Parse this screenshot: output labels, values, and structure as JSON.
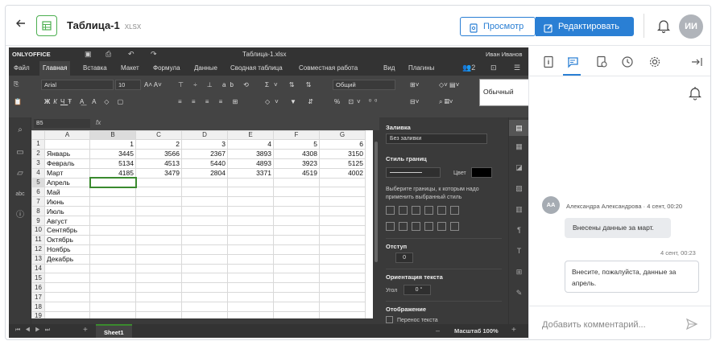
{
  "header": {
    "title": "Таблица-1",
    "ext": "XLSX",
    "view_label": "Просмотр",
    "edit_label": "Редактировать",
    "avatar": "ИИ"
  },
  "editor": {
    "logo": "ONLYOFFICE",
    "filename": "Таблица-1.xlsx",
    "user": "Иван Иванов",
    "menu": [
      "Файл",
      "Главная",
      "Вставка",
      "Макет",
      "Формула",
      "Данные",
      "Сводная таблица",
      "Совместная работа",
      "Вид",
      "Плагины"
    ],
    "font_name": "Arial",
    "font_size": "10",
    "number_format": "Общий",
    "cell_style": "Обычный",
    "name_box": "B5",
    "fx": "fx",
    "sheet_tab": "Sheet1",
    "zoom": "Масштаб 100%",
    "users_count": "2"
  },
  "grid": {
    "columns": [
      "A",
      "B",
      "C",
      "D",
      "E",
      "F",
      "G"
    ],
    "rows": [
      {
        "n": "1",
        "a": "",
        "v": [
          "1",
          "2",
          "3",
          "4",
          "5",
          "6"
        ]
      },
      {
        "n": "2",
        "a": "Январь",
        "v": [
          "3445",
          "3566",
          "2367",
          "3893",
          "4308",
          "3150"
        ]
      },
      {
        "n": "3",
        "a": "Февраль",
        "v": [
          "5134",
          "4513",
          "5440",
          "4893",
          "3923",
          "5125"
        ]
      },
      {
        "n": "4",
        "a": "Март",
        "v": [
          "4185",
          "3479",
          "2804",
          "3371",
          "4519",
          "4002"
        ]
      },
      {
        "n": "5",
        "a": "Апрель",
        "v": [
          "",
          "",
          "",
          "",
          "",
          ""
        ]
      },
      {
        "n": "6",
        "a": "Май",
        "v": [
          "",
          "",
          "",
          "",
          "",
          ""
        ]
      },
      {
        "n": "7",
        "a": "Июнь",
        "v": [
          "",
          "",
          "",
          "",
          "",
          ""
        ]
      },
      {
        "n": "8",
        "a": "Июль",
        "v": [
          "",
          "",
          "",
          "",
          "",
          ""
        ]
      },
      {
        "n": "9",
        "a": "Август",
        "v": [
          "",
          "",
          "",
          "",
          "",
          ""
        ]
      },
      {
        "n": "10",
        "a": "Сентябрь",
        "v": [
          "",
          "",
          "",
          "",
          "",
          ""
        ]
      },
      {
        "n": "11",
        "a": "Октябрь",
        "v": [
          "",
          "",
          "",
          "",
          "",
          ""
        ]
      },
      {
        "n": "12",
        "a": "Ноябрь",
        "v": [
          "",
          "",
          "",
          "",
          "",
          ""
        ]
      },
      {
        "n": "13",
        "a": "Декабрь",
        "v": [
          "",
          "",
          "",
          "",
          "",
          ""
        ]
      },
      {
        "n": "14",
        "a": "",
        "v": [
          "",
          "",
          "",
          "",
          "",
          ""
        ]
      },
      {
        "n": "15",
        "a": "",
        "v": [
          "",
          "",
          "",
          "",
          "",
          ""
        ]
      },
      {
        "n": "16",
        "a": "",
        "v": [
          "",
          "",
          "",
          "",
          "",
          ""
        ]
      },
      {
        "n": "17",
        "a": "",
        "v": [
          "",
          "",
          "",
          "",
          "",
          ""
        ]
      },
      {
        "n": "18",
        "a": "",
        "v": [
          "",
          "",
          "",
          "",
          "",
          ""
        ]
      },
      {
        "n": "19",
        "a": "",
        "v": [
          "",
          "",
          "",
          "",
          "",
          ""
        ]
      }
    ]
  },
  "settings": {
    "fill_title": "Заливка",
    "fill_value": "Без заливки",
    "border_style_title": "Стиль границ",
    "color_label": "Цвет",
    "border_hint": "Выберите границы, к которым надо применить выбранный стиль",
    "indent_title": "Отступ",
    "indent_value": "0",
    "orientation_title": "Ориентация текста",
    "angle_label": "Угол",
    "angle_value": "0 °",
    "display_title": "Отображение",
    "wrap_label": "Перенос текста"
  },
  "comments": {
    "author": "Александра Александрова · 4 сент, 00:20",
    "author_initials": "АА",
    "comment1": "Внесены данные за март.",
    "time2": "4 сент, 00:23",
    "comment2": "Внесите, пожалуйста, данные за апрель.",
    "input_placeholder": "Добавить комментарий..."
  },
  "colors": {
    "accent": "#2a7fd4",
    "green": "#4caf50",
    "dark": "#3a3a3a"
  }
}
